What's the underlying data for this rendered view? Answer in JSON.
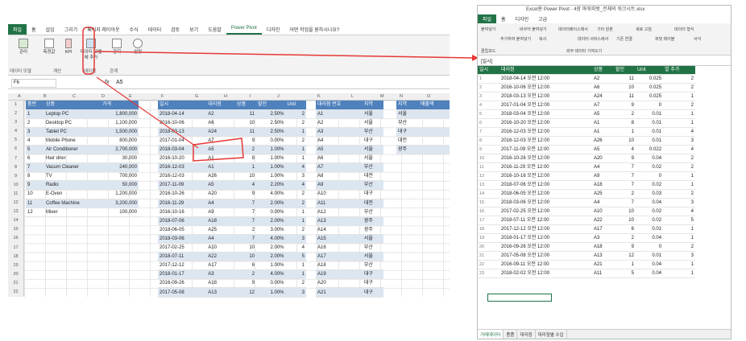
{
  "excel": {
    "tabs": [
      "파일",
      "홈",
      "삽입",
      "그리기",
      "페이지 레이아웃",
      "수식",
      "데이터",
      "검토",
      "보기",
      "도움말",
      "Power Pivot",
      "디자인",
      "어떤 작업을 원하시나요?"
    ],
    "ribbon": {
      "manage": "관리",
      "measures": "측정값",
      "kpi": "KPI",
      "add_model": "데이터 모델에 추가",
      "detect": "감지",
      "settings": "설정",
      "group_model": "데이터 모델",
      "group_calc": "계산",
      "group_tables": "테이블",
      "group_rel": "관계"
    },
    "formula": {
      "cellref": "F6",
      "fx": "fx",
      "value": "A5"
    },
    "columns": [
      "A",
      "B",
      "C",
      "D",
      "E",
      "F",
      "G",
      "H",
      "I",
      "J",
      "K",
      "L",
      "M",
      "N",
      "O"
    ],
    "rows": [
      "1",
      "2",
      "3",
      "4",
      "5",
      "6",
      "7",
      "8",
      "9",
      "10",
      "11",
      "12",
      "13",
      "14",
      "15",
      "16",
      "17",
      "18",
      "19",
      "20",
      "21",
      "22"
    ],
    "products": {
      "headers": [
        "품번",
        "상품",
        "가격"
      ],
      "rows": [
        [
          "1",
          "Leptop PC",
          "1,800,000"
        ],
        [
          "2",
          "Desktop PC",
          "1,100,000"
        ],
        [
          "3",
          "Tablet PC",
          "1,500,000"
        ],
        [
          "4",
          "Mobile Phone",
          "800,000"
        ],
        [
          "5",
          "Air Conditioner",
          "2,700,000"
        ],
        [
          "6",
          "Hair drier",
          "30,000"
        ],
        [
          "7",
          "Vacum Cleaner",
          "240,000"
        ],
        [
          "8",
          "TV",
          "700,000"
        ],
        [
          "9",
          "Radio",
          "50,000"
        ],
        [
          "10",
          "E-Oven",
          "1,200,000"
        ],
        [
          "11",
          "Coffee Machine",
          "3,200,000"
        ],
        [
          "12",
          "Mixer",
          "100,000"
        ]
      ]
    },
    "sales": {
      "headers": [
        "일시",
        "대리점",
        "상품",
        "할인",
        "Unit"
      ],
      "rows": [
        [
          "2018-04-14",
          "A2",
          "11",
          "2.50%",
          "2"
        ],
        [
          "2016-10-06",
          "A6",
          "10",
          "2.50%",
          "2"
        ],
        [
          "2018-03-13",
          "A24",
          "11",
          "2.50%",
          "1"
        ],
        [
          "2017-01-04",
          "A7",
          "9",
          "0.00%",
          "2"
        ],
        [
          "2018-03-04",
          "A5",
          "2",
          "1.00%",
          "1"
        ],
        [
          "2016-10-20",
          "A1",
          "8",
          "1.00%",
          "1"
        ],
        [
          "2016-12-03",
          "A1",
          "1",
          "1.00%",
          "4"
        ],
        [
          "2016-12-03",
          "A26",
          "10",
          "1.00%",
          "3"
        ],
        [
          "2017-11-09",
          "A5",
          "4",
          "2.20%",
          "4"
        ],
        [
          "2016-10-26",
          "A20",
          "9",
          "4.00%",
          "2"
        ],
        [
          "2016-11-29",
          "A4",
          "7",
          "2.00%",
          "2"
        ],
        [
          "2016-10-16",
          "A9",
          "7",
          "0.00%",
          "1"
        ],
        [
          "2018-07-06",
          "A18",
          "7",
          "2.00%",
          "1"
        ],
        [
          "2018-06-05",
          "A25",
          "2",
          "3.00%",
          "2"
        ],
        [
          "2018-03-06",
          "A4",
          "7",
          "4.00%",
          "3"
        ],
        [
          "2017-02-25",
          "A10",
          "10",
          "2.00%",
          "4"
        ],
        [
          "2018-07-11",
          "A22",
          "10",
          "2.00%",
          "5"
        ],
        [
          "2017-12-12",
          "A17",
          "6",
          "1.00%",
          "1"
        ],
        [
          "2018-01-17",
          "A3",
          "2",
          "4.00%",
          "1"
        ],
        [
          "2016-09-26",
          "A18",
          "9",
          "0.00%",
          "2"
        ],
        [
          "2017-05-08",
          "A13",
          "12",
          "1.00%",
          "3"
        ]
      ]
    },
    "agency": {
      "headers": [
        "대리점 번호",
        "지역"
      ],
      "rows": [
        [
          "A1",
          "서울"
        ],
        [
          "A2",
          "서울"
        ],
        [
          "A3",
          "부산"
        ],
        [
          "A4",
          "대구"
        ],
        [
          "A5",
          "서울"
        ],
        [
          "A6",
          "서울"
        ],
        [
          "A7",
          "부산"
        ],
        [
          "A8",
          "대전"
        ],
        [
          "A9",
          "부산"
        ],
        [
          "A10",
          "대구"
        ],
        [
          "A11",
          "대전"
        ],
        [
          "A12",
          "부산"
        ],
        [
          "A13",
          "광주"
        ],
        [
          "A14",
          "광주"
        ],
        [
          "A15",
          "서울"
        ],
        [
          "A16",
          "부산"
        ],
        [
          "A17",
          "서울"
        ],
        [
          "A18",
          "부산"
        ],
        [
          "A19",
          "대구"
        ],
        [
          "A20",
          "대구"
        ],
        [
          "A21",
          "대구"
        ]
      ]
    },
    "region": {
      "headers": [
        "지역",
        "매출액"
      ],
      "rows": [
        "서울",
        "부산",
        "대구",
        "대전",
        "광주"
      ]
    }
  },
  "pp": {
    "title": "Excel용 Power Pivot - 4장 파워피벗_전체의 워크시트.xlsx",
    "tabs": [
      "파일",
      "홈",
      "디자인",
      "고급"
    ],
    "ribbon": [
      "붙여넣기",
      "추가하여 붙여넣기",
      "바꾸어 붙여넣기",
      "복사",
      "데이터베이스에서",
      "데이터 서비스에서",
      "기타 원본",
      "기존 연결",
      "새로 고침",
      "피벗 테이블",
      "데이터 형식",
      "서식",
      "클립보드",
      "외부 데이터 가져오기"
    ],
    "cellref": "[일시]",
    "headers": [
      "일시",
      "대리점",
      "상품",
      "할인",
      "Unit",
      "열 추가"
    ],
    "rows": [
      [
        "2018-04-14 오전 12:00",
        "A2",
        "11",
        "0.025",
        "2"
      ],
      [
        "2016-10-06 오전 12:00",
        "A6",
        "10",
        "0.025",
        "2"
      ],
      [
        "2018-03-13 오전 12:00",
        "A24",
        "11",
        "0.025",
        "1"
      ],
      [
        "2017-01-04 오전 12:00",
        "A7",
        "9",
        "0",
        "2"
      ],
      [
        "2018-03-04 오전 12:00",
        "A5",
        "2",
        "0.01",
        "1"
      ],
      [
        "2016-10-20 오전 12:00",
        "A1",
        "8",
        "0.01",
        "1"
      ],
      [
        "2016-12-03 오전 12:00",
        "A1",
        "1",
        "0.01",
        "4"
      ],
      [
        "2016-12-03 오전 12:00",
        "A26",
        "10",
        "0.01",
        "3"
      ],
      [
        "2017-11-09 오전 12:00",
        "A5",
        "4",
        "0.022",
        "4"
      ],
      [
        "2016-10-26 오전 12:00",
        "A20",
        "9",
        "0.04",
        "2"
      ],
      [
        "2016-11-29 오전 12:00",
        "A4",
        "7",
        "0.02",
        "2"
      ],
      [
        "2016-10-16 오전 12:00",
        "A9",
        "7",
        "0",
        "1"
      ],
      [
        "2018-07-06 오전 12:00",
        "A18",
        "7",
        "0.02",
        "1"
      ],
      [
        "2018-06-05 오전 12:00",
        "A25",
        "2",
        "0.03",
        "2"
      ],
      [
        "2018-03-06 오전 12:00",
        "A4",
        "7",
        "0.04",
        "3"
      ],
      [
        "2017-02-25 오전 12:00",
        "A10",
        "10",
        "0.02",
        "4"
      ],
      [
        "2018-07-11 오전 12:00",
        "A22",
        "10",
        "0.02",
        "5"
      ],
      [
        "2017-12-12 오전 12:00",
        "A17",
        "6",
        "0.01",
        "1"
      ],
      [
        "2018-01-17 오전 12:00",
        "A3",
        "2",
        "0.04",
        "1"
      ],
      [
        "2016-09-26 오전 12:00",
        "A18",
        "9",
        "0",
        "2"
      ],
      [
        "2017-05-08 오전 12:00",
        "A13",
        "12",
        "0.01",
        "3"
      ],
      [
        "2016-09-11 오전 12:00",
        "A21",
        "1",
        "0.04",
        "1"
      ],
      [
        "2018-02-02 오전 12:00",
        "A11",
        "5",
        "0.04",
        "1"
      ]
    ],
    "sheets": [
      "거래데이터",
      "품품",
      "대리점",
      "대리점별 수입"
    ]
  }
}
